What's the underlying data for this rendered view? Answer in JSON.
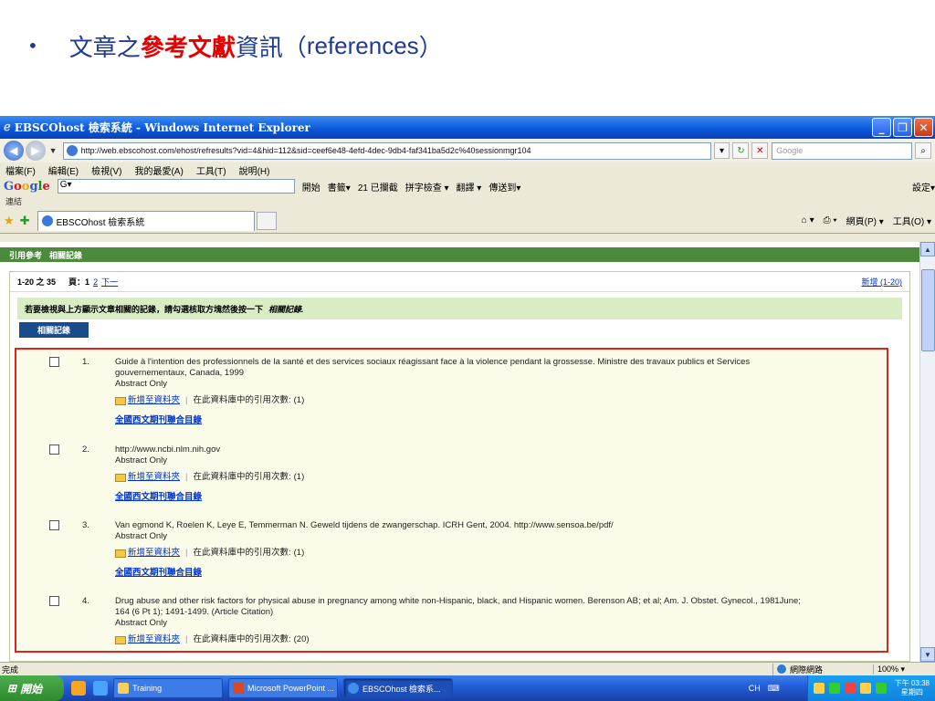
{
  "slide": {
    "bullet": "•",
    "title_pre": "文章之",
    "title_red": "參考文獻",
    "title_post": "資訊（",
    "title_latin": "references",
    "title_close": "）"
  },
  "window": {
    "title": "EBSCOhost 檢索系統 - Windows Internet Explorer",
    "url": "http://web.ebscohost.com/ehost/refresults?vid=4&hid=112&sid=ceef6e48-4efd-4dec-9db4-faf341ba5d2c%40sessionmgr104",
    "search_placeholder": "Google"
  },
  "menu": [
    "檔案(F)",
    "編輯(E)",
    "檢視(V)",
    "我的最愛(A)",
    "工具(T)",
    "說明(H)"
  ],
  "google_toolbar": {
    "logo_b": "G",
    "logo_o1": "o",
    "logo_o2": "o",
    "logo_g": "g",
    "logo_l": "l",
    "logo_e": "e",
    "input": "G▾",
    "start": "開始",
    "bookmarks": "書籤▾",
    "blocked": "21 已攔截",
    "spell": "拼字檢查 ▾",
    "translate": "翻譯 ▾",
    "send": "傳送到▾",
    "settings": "設定▾",
    "links": "連結"
  },
  "tabs": {
    "active": "EBSCOhost 檢索系統",
    "page_menu": "網頁(P) ▾",
    "tools_menu": "工具(O) ▾"
  },
  "content": {
    "section_label": "引用參考",
    "section_sub": "相關記錄",
    "range": "1-20 之 35",
    "page_label": "頁：",
    "page_current": "1",
    "page_2": "2",
    "page_next": "下一",
    "new_link": "新增 (1-20)",
    "notice": "若要檢視與上方顯示文章相關的記錄，請勾選核取方塊然後按一下",
    "notice_link": "相關記錄.",
    "related_button": "相關記錄",
    "add_folder": "新增至資料夾",
    "cited_label": "在此資料庫中的引用次數:",
    "catalog": "全國西文期刊聯合目錄",
    "results": [
      {
        "num": "1.",
        "line1": "Guide à l'intention des professionnels de la santé et des services sociaux réagissant face à la violence pendant la grossesse. Ministre des travaux publics et Services",
        "line2": "gouvernementaux, Canada, 1999",
        "line3": "Abstract Only",
        "count": "(1)"
      },
      {
        "num": "2.",
        "line1": "http://www.ncbi.nlm.nih.gov",
        "line2": "Abstract Only",
        "line3": "",
        "count": "(1)"
      },
      {
        "num": "3.",
        "line1": "Van egmond K, Roelen K, Leye E, Temmerman N. Geweld tijdens de zwangerschap. ICRH Gent, 2004. http://www.sensoa.be/pdf/",
        "line2": "Abstract Only",
        "line3": "",
        "count": "(1)"
      },
      {
        "num": "4.",
        "line1": "Drug abuse and other risk factors for physical abuse in pregnancy among white non-Hispanic, black, and Hispanic women. Berenson AB; et al; Am. J. Obstet. Gynecol., 1981June;",
        "line2": "164 (6 Pt 1); 1491-1499. (Article Citation)",
        "line3": "Abstract Only",
        "count": "(20)"
      }
    ]
  },
  "status": {
    "text": "完成",
    "zone": "網際網路",
    "zoom": "100% ▾"
  },
  "taskbar": {
    "start": "開始",
    "tasks": [
      "Training",
      "Microsoft PowerPoint ...",
      "EBSCOhost 檢索系..."
    ],
    "ime": "CH",
    "time": "下午 03:38",
    "day": "星期四"
  }
}
